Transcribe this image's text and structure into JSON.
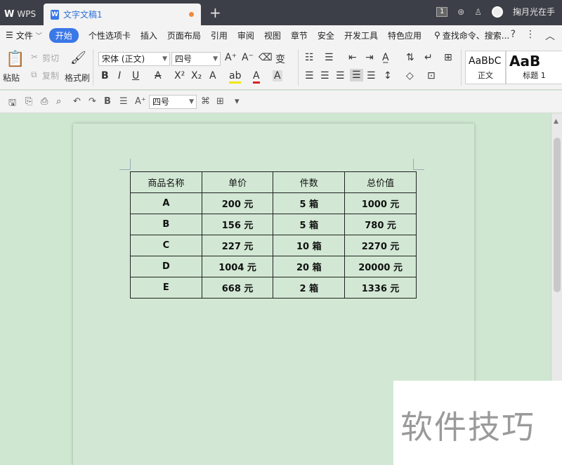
{
  "titlebar": {
    "app_label": "WPS",
    "doc_tab": "文字文稿1",
    "new_tab_symbol": "+",
    "badge_count": "1",
    "user_name": "掬月光在手"
  },
  "menubar": {
    "file": "文件",
    "active_tab": "开始",
    "tabs": [
      "个性选项卡",
      "插入",
      "页面布局",
      "引用",
      "审阅",
      "视图",
      "章节",
      "安全",
      "开发工具",
      "特色应用"
    ],
    "search": "查找命令、搜索..."
  },
  "ribbon": {
    "paste": "粘贴",
    "cut": "剪切",
    "copy": "复制",
    "format_painter": "格式刷",
    "font_family": "宋体 (正文)",
    "font_size": "四号",
    "styles": [
      {
        "sample": "AaBbC",
        "name": "正文"
      },
      {
        "sample": "AaB",
        "name": "标题 1"
      }
    ]
  },
  "qat": {
    "font_size": "四号"
  },
  "table": {
    "headers": [
      "商品名称",
      "单价",
      "件数",
      "总价值"
    ],
    "rows": [
      [
        "A",
        "200 元",
        "5 箱",
        "1000 元"
      ],
      [
        "B",
        "156 元",
        "5 箱",
        "780 元"
      ],
      [
        "C",
        "227 元",
        "10 箱",
        "2270 元"
      ],
      [
        "D",
        "1004 元",
        "20 箱",
        "20000 元"
      ],
      [
        "E",
        "668 元",
        "2 箱",
        "1336 元"
      ]
    ]
  },
  "watermark": "软件技巧",
  "colors": {
    "accent": "#3b78e7",
    "titlebar": "#3d3f48",
    "page_bg": "#d2e8d4"
  }
}
